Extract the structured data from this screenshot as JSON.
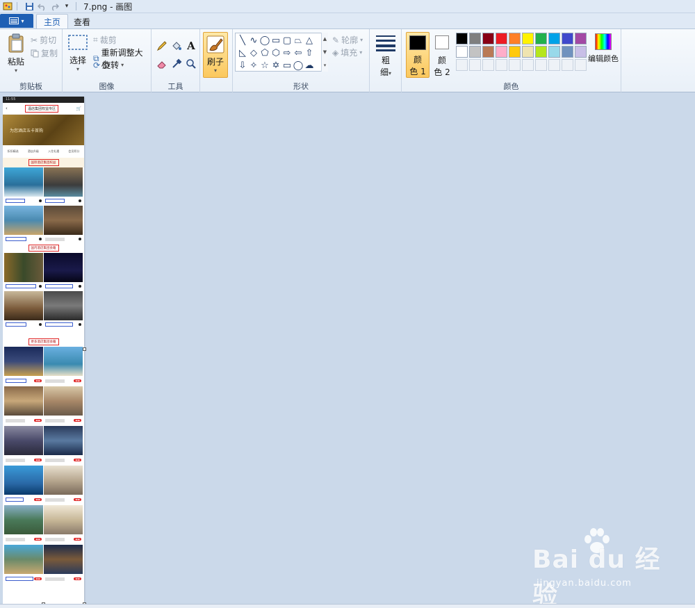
{
  "window": {
    "title": "7.png - 画图"
  },
  "tabs": {
    "file_label": "",
    "home": "主页",
    "view": "查看"
  },
  "clipboard": {
    "paste": "粘贴",
    "cut": "剪切",
    "copy": "复制",
    "label": "剪贴板"
  },
  "image": {
    "select": "选择",
    "crop": "裁剪",
    "resize": "重新调整大小",
    "rotate": "旋转",
    "label": "图像"
  },
  "tools": {
    "label": "工具",
    "brush": "刷子"
  },
  "shapes": {
    "outline": "轮廓",
    "fill": "填充",
    "label": "形状"
  },
  "size": {
    "line1": "粗",
    "line2": "细"
  },
  "colors": {
    "color1_line1": "颜",
    "color1_line2": "色 1",
    "color2_line1": "颜",
    "color2_line2": "色 2",
    "edit": "编辑颜色",
    "label": "颜色",
    "palette_row1": [
      "#000000",
      "#7f7f7f",
      "#880015",
      "#ed1c24",
      "#ff7f27",
      "#fff200",
      "#22b14c",
      "#00a2e8",
      "#3f48cc",
      "#a349a4"
    ],
    "palette_row2": [
      "#ffffff",
      "#c3c3c3",
      "#b97a57",
      "#ffaec9",
      "#ffc90e",
      "#efe4b0",
      "#b5e61d",
      "#99d9ea",
      "#7092be",
      "#c8bfe7"
    ]
  },
  "document": {
    "status_time": "11:55",
    "page_title": "酒店集团权益专区",
    "banner": "为您酒店五卡首购",
    "categories": [
      "折扣精选",
      "酒店升级",
      "入住礼遇",
      "会员积分"
    ],
    "section1": "国际酒店集团权益",
    "section2": "国内酒店集团会籍",
    "section3": "更多酒店集团会籍"
  },
  "watermark": {
    "main": "Bai du 经验",
    "sub": "jingyan.baidu.com"
  }
}
